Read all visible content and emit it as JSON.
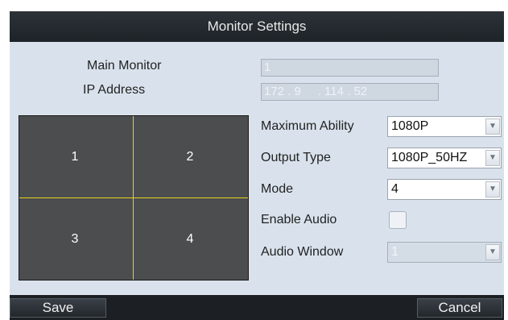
{
  "title": "Monitor Settings",
  "fields": {
    "main_monitor": {
      "label": "Main Monitor",
      "value": "1"
    },
    "ip_address": {
      "label": "IP Address",
      "value": "172 . 9     . 114 . 52"
    },
    "maximum_ability": {
      "label": "Maximum Ability",
      "value": "1080P"
    },
    "output_type": {
      "label": "Output Type",
      "value": "1080P_50HZ"
    },
    "mode": {
      "label": "Mode",
      "value": "4"
    },
    "enable_audio": {
      "label": "Enable Audio",
      "checked": false
    },
    "audio_window": {
      "label": "Audio Window",
      "value": "1"
    }
  },
  "layout_cells": [
    "1",
    "2",
    "3",
    "4"
  ],
  "buttons": {
    "save": "Save",
    "cancel": "Cancel"
  },
  "colors": {
    "titlebar": "#1e2328",
    "panel": "#d9e2ec",
    "grid_bg": "#4b4d4f",
    "grid_lines": "#e8d21c"
  }
}
